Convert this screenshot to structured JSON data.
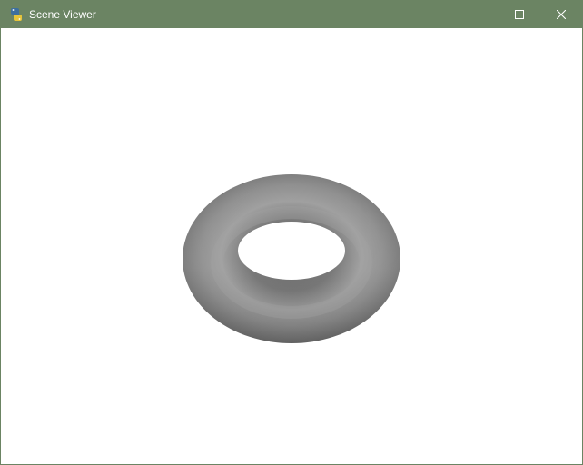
{
  "window": {
    "title": "Scene Viewer",
    "titlebar_color": "#6b8463",
    "app_icon": "python-icon"
  },
  "controls": {
    "minimize_icon": "minimize-icon",
    "maximize_icon": "maximize-icon",
    "close_icon": "close-icon"
  },
  "scene": {
    "background": "#ffffff",
    "object": "torus",
    "object_color": "#8c8c8c"
  }
}
